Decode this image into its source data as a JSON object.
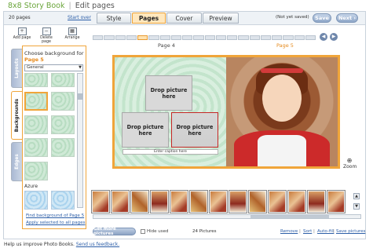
{
  "header": {
    "app_title": "8x8 Story Book",
    "separator": "|",
    "page_title": "Edit pages"
  },
  "topbar": {
    "pages_count": "20 pages",
    "start_over": "Start over",
    "tabs": [
      {
        "label": "Style",
        "active": false
      },
      {
        "label": "Pages",
        "active": true
      },
      {
        "label": "Cover",
        "active": false
      },
      {
        "label": "Preview",
        "active": false
      }
    ],
    "save_status": "(Not yet saved)",
    "save_label": "Save",
    "next_label": "Next ›"
  },
  "toolbar": {
    "add_page": "Add page",
    "delete_page": "Delete page",
    "arrange": "Arrange"
  },
  "pager": {
    "left_page": "Page 4",
    "right_page": "Page 5",
    "segments": 20,
    "current_index": 4
  },
  "side_tabs": [
    "Layouts",
    "Backgrounds",
    "Edges"
  ],
  "backgrounds": {
    "choose_label": "Choose background for",
    "choose_page": "Page 5",
    "category": "General",
    "section_label": "Azure",
    "find_link": "Find background of Page 5",
    "apply_link": "Apply selected to all pages"
  },
  "spread": {
    "drop_label": "Drop picture here",
    "caption_placeholder": "Enter caption here"
  },
  "zoom_label": "Zoom",
  "filmstrip": {
    "thumbnail_count": 13,
    "get_more": "Get more pictures",
    "hide_used": "Hide used",
    "picture_count": "24 Pictures",
    "links": [
      "Remove",
      "Sort",
      "Auto-fill",
      "Save pictures"
    ],
    "link_separator": "|"
  },
  "footer": {
    "text": "Help us improve Photo Books.",
    "link": "Send us feedback."
  },
  "colors": {
    "accent_orange": "#f0a53a",
    "brand_green": "#6aa53a",
    "link_blue": "#2d5fa8"
  }
}
